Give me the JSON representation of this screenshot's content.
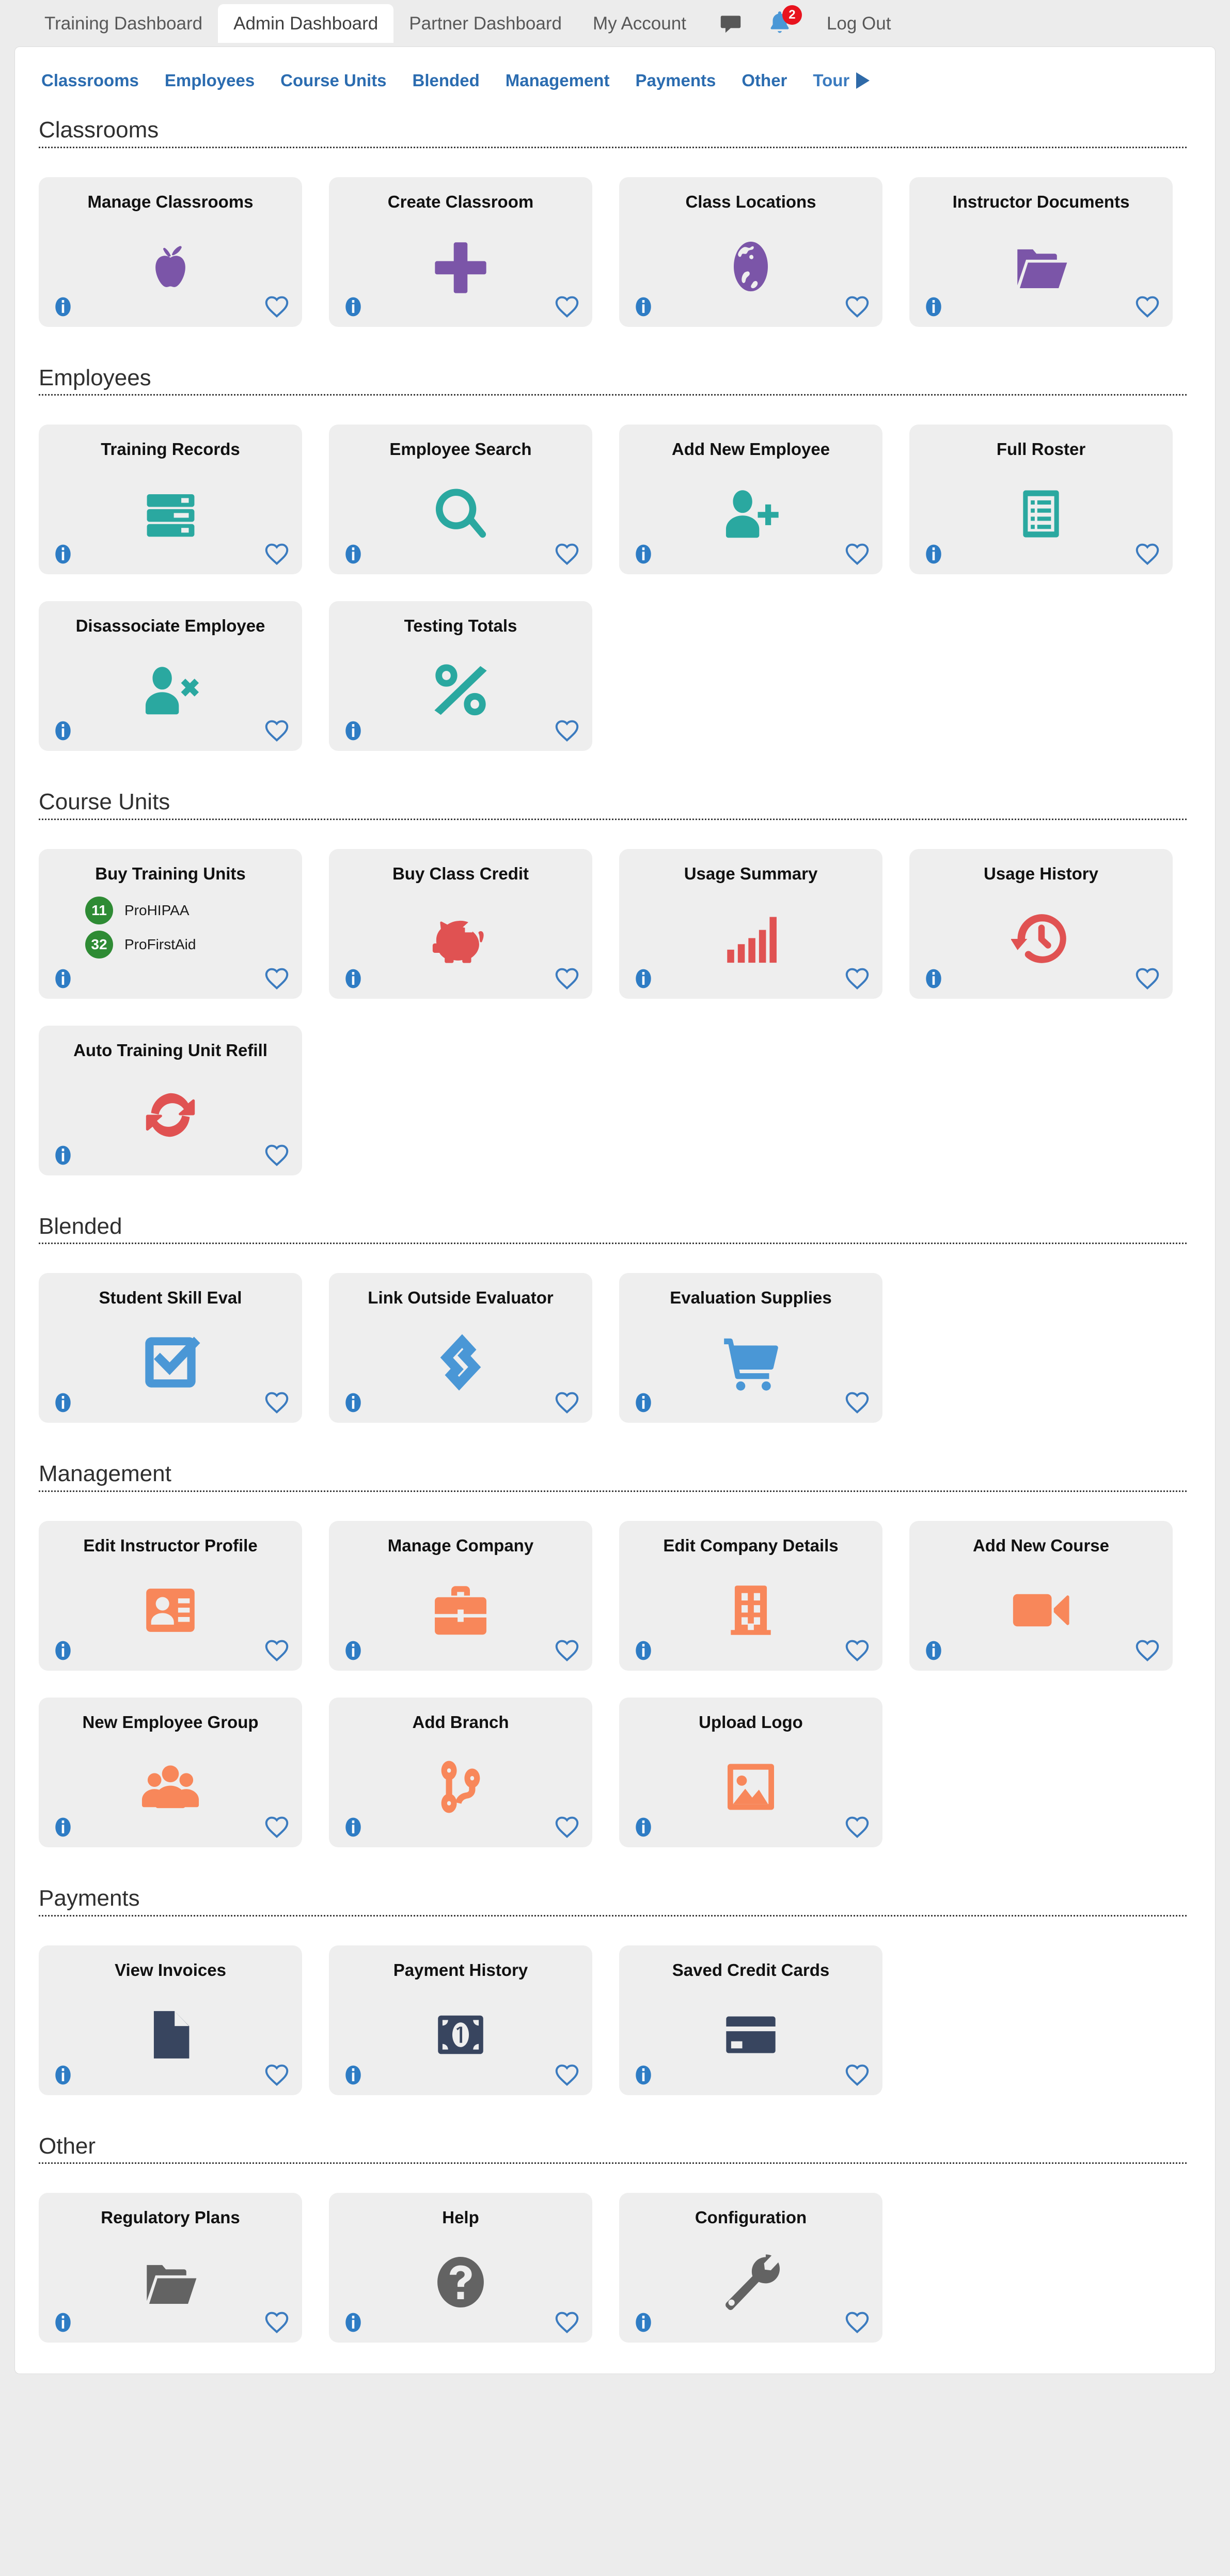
{
  "topnav": {
    "items": [
      {
        "label": "Training Dashboard",
        "active": false
      },
      {
        "label": "Admin Dashboard",
        "active": true
      },
      {
        "label": "Partner Dashboard",
        "active": false
      },
      {
        "label": "My Account",
        "active": false
      }
    ],
    "logout_label": "Log Out",
    "notification_count": "2",
    "chat_icon": "chat-bubble-icon",
    "bell_icon": "bell-icon"
  },
  "anchor_nav": {
    "links": [
      "Classrooms",
      "Employees",
      "Course Units",
      "Blended",
      "Management",
      "Payments",
      "Other"
    ],
    "tour_label": "Tour"
  },
  "colors": {
    "classrooms": "#7b55a8",
    "employees": "#2aa8a0",
    "course_units": "#e05252",
    "blended": "#4a97d6",
    "management": "#f8875a",
    "payments": "#38455f",
    "other": "#636363",
    "info": "#2e7cc4",
    "favorite": "#3b7bbf",
    "badge_green": "#2e8b34",
    "notification_red": "#e8131e"
  },
  "sections": [
    {
      "title": "Classrooms",
      "accent": "#7b55a8",
      "cards": [
        {
          "title": "Manage Classrooms",
          "icon": "apple-icon"
        },
        {
          "title": "Create Classroom",
          "icon": "plus-icon"
        },
        {
          "title": "Class Locations",
          "icon": "globe-icon"
        },
        {
          "title": "Instructor Documents",
          "icon": "open-folder-icon"
        }
      ]
    },
    {
      "title": "Employees",
      "accent": "#2aa8a0",
      "cards": [
        {
          "title": "Training Records",
          "icon": "server-stack-icon"
        },
        {
          "title": "Employee Search",
          "icon": "magnifier-icon"
        },
        {
          "title": "Add New Employee",
          "icon": "user-plus-icon"
        },
        {
          "title": "Full Roster",
          "icon": "clipboard-list-icon"
        },
        {
          "title": "Disassociate Employee",
          "icon": "user-times-icon"
        },
        {
          "title": "Testing Totals",
          "icon": "percent-icon"
        }
      ]
    },
    {
      "title": "Course Units",
      "accent": "#e05252",
      "cards": [
        {
          "title": "Buy Training Units",
          "icon": "unit-balance-list",
          "units": [
            {
              "count": "11",
              "name": "ProHIPAA"
            },
            {
              "count": "32",
              "name": "ProFirstAid"
            }
          ]
        },
        {
          "title": "Buy Class Credit",
          "icon": "piggy-bank-icon"
        },
        {
          "title": "Usage Summary",
          "icon": "bar-chart-icon"
        },
        {
          "title": "Usage History",
          "icon": "history-clock-icon"
        },
        {
          "title": "Auto Training Unit Refill",
          "icon": "sync-arrows-icon"
        }
      ]
    },
    {
      "title": "Blended",
      "accent": "#4a97d6",
      "cards": [
        {
          "title": "Student Skill Eval",
          "icon": "check-square-icon"
        },
        {
          "title": "Link Outside Evaluator",
          "icon": "chain-link-icon"
        },
        {
          "title": "Evaluation Supplies",
          "icon": "shopping-cart-icon"
        }
      ]
    },
    {
      "title": "Management",
      "accent": "#f8875a",
      "cards": [
        {
          "title": "Edit Instructor Profile",
          "icon": "id-card-icon"
        },
        {
          "title": "Manage Company",
          "icon": "briefcase-icon"
        },
        {
          "title": "Edit Company Details",
          "icon": "building-icon"
        },
        {
          "title": "Add New Course",
          "icon": "video-camera-icon"
        },
        {
          "title": "New Employee Group",
          "icon": "users-group-icon"
        },
        {
          "title": "Add Branch",
          "icon": "code-branch-icon"
        },
        {
          "title": "Upload Logo",
          "icon": "image-icon"
        }
      ]
    },
    {
      "title": "Payments",
      "accent": "#38455f",
      "cards": [
        {
          "title": "View Invoices",
          "icon": "document-icon"
        },
        {
          "title": "Payment History",
          "icon": "money-bill-icon"
        },
        {
          "title": "Saved Credit Cards",
          "icon": "credit-card-icon"
        }
      ]
    },
    {
      "title": "Other",
      "accent": "#636363",
      "cards": [
        {
          "title": "Regulatory Plans",
          "icon": "open-folder-icon"
        },
        {
          "title": "Help",
          "icon": "question-circle-icon"
        },
        {
          "title": "Configuration",
          "icon": "wrench-icon"
        }
      ]
    }
  ]
}
